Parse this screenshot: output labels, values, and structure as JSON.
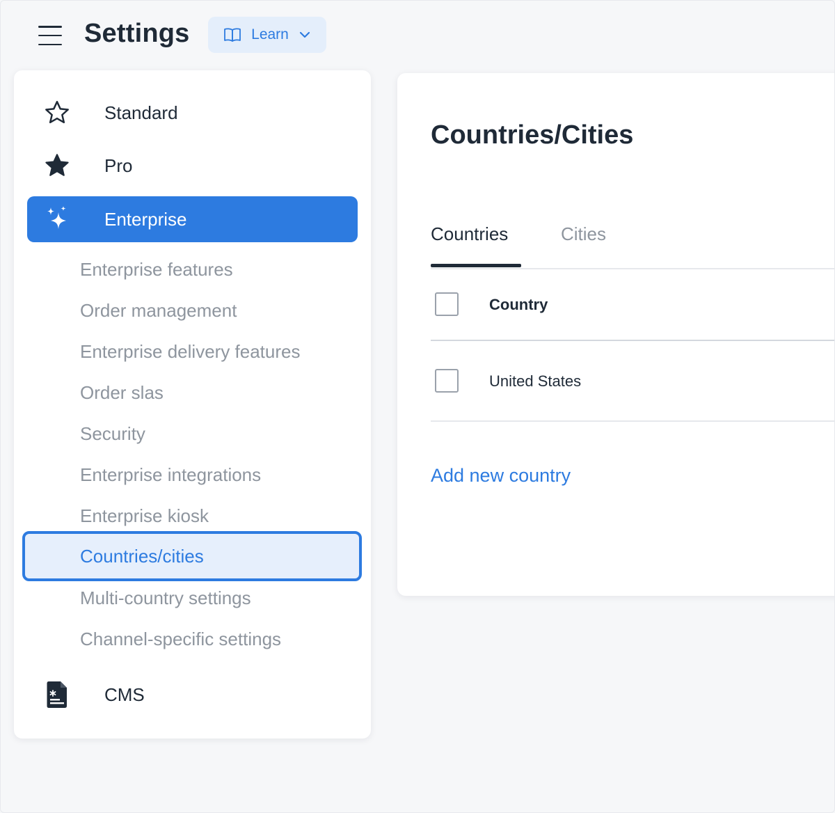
{
  "header": {
    "title": "Settings",
    "learn_label": "Learn"
  },
  "sidebar": {
    "plans": [
      {
        "label": "Standard",
        "icon": "star-outline-icon"
      },
      {
        "label": "Pro",
        "icon": "star-filled-icon"
      },
      {
        "label": "Enterprise",
        "icon": "sparkles-icon",
        "active": true
      }
    ],
    "enterprise_items": [
      "Enterprise features",
      "Order management",
      "Enterprise delivery features",
      "Order slas",
      "Security",
      "Enterprise integrations",
      "Enterprise kiosk",
      "Countries/cities",
      "Multi-country settings",
      "Channel-specific settings"
    ],
    "selected_item": "Countries/cities",
    "cms": {
      "label": "CMS",
      "icon": "document-icon"
    }
  },
  "main": {
    "title": "Countries/Cities",
    "tabs": [
      {
        "label": "Countries",
        "active": true
      },
      {
        "label": "Cities",
        "active": false
      }
    ],
    "table": {
      "column_header": "Country",
      "rows": [
        "United States"
      ]
    },
    "add_link": "Add new country"
  },
  "colors": {
    "accent": "#2d7be0",
    "text": "#1f2a37",
    "muted": "#8e959e",
    "learn_bg": "#e4eefb",
    "selected_bg": "#e6effc"
  }
}
